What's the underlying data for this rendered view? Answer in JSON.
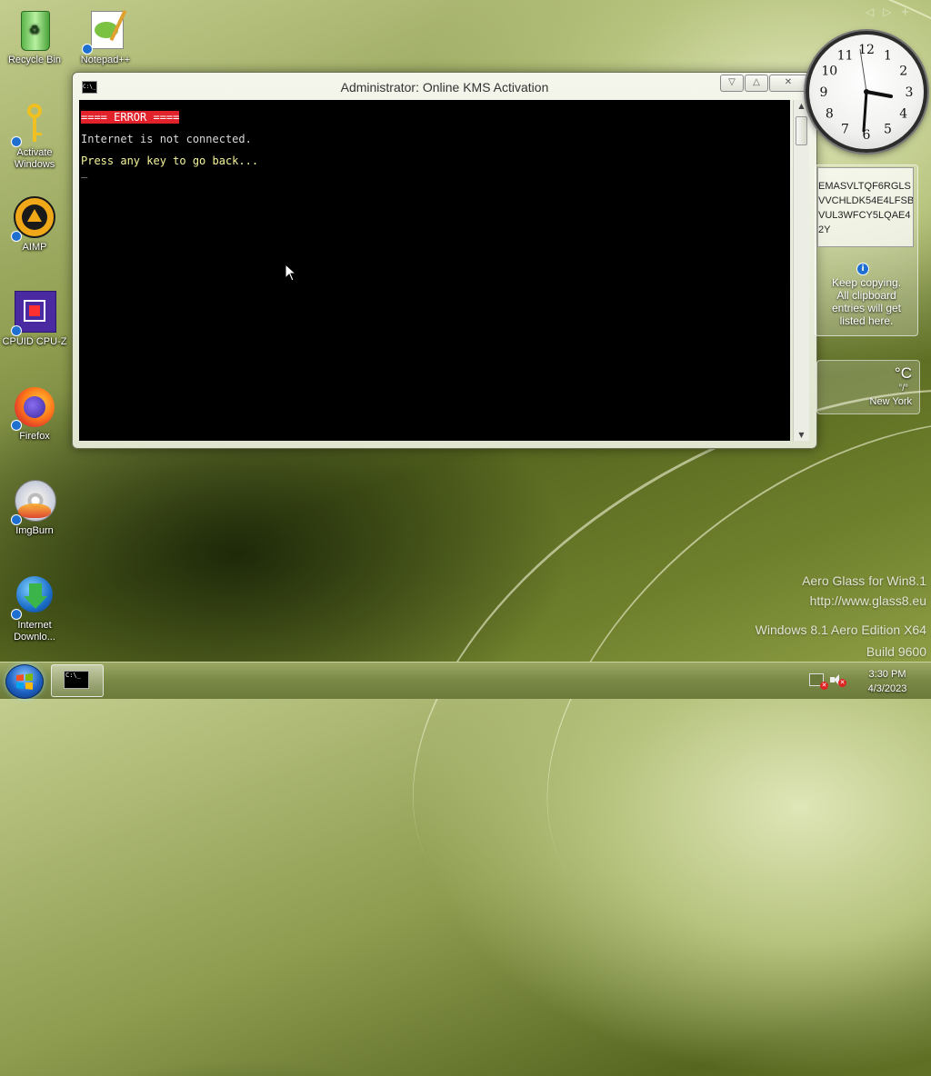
{
  "desktop": {
    "icons": [
      {
        "label": "Recycle Bin"
      },
      {
        "label": "Notepad++"
      },
      {
        "label": "Activate\nWindows"
      },
      {
        "label": "AIMP"
      },
      {
        "label": "CPUID CPU-Z"
      },
      {
        "label": "Firefox"
      },
      {
        "label": "ImgBurn"
      },
      {
        "label": "Internet\nDownlo..."
      }
    ]
  },
  "window": {
    "title": "Administrator:  Online KMS Activation",
    "title_icon_text": "C:\\_",
    "buttons": {
      "minimize": "▽",
      "maximize": "△",
      "close": "✕"
    },
    "console_lines": [
      {
        "text": "==== ERROR ====",
        "color": "#ffffff",
        "bg": "#e1222a"
      },
      {
        "text": "Internet is not connected.",
        "color": "#d8d8d8"
      },
      {
        "text": "Press any key to go back...",
        "color": "#f5f59a"
      }
    ],
    "cursor": "_"
  },
  "gadgets": {
    "clock": {
      "time": "3:30 PM",
      "numbers": [
        "12",
        "1",
        "2",
        "3",
        "4",
        "5",
        "6",
        "7",
        "8",
        "9",
        "10",
        "11"
      ]
    },
    "clipboard": {
      "entry_lines": [
        "EMASVLTQF6RGLS",
        "VVCHLDK54E4LFSB",
        "VUL3WFCY5LQAE4",
        "2Y"
      ],
      "info_icon": "i",
      "hint": "Keep copying.\nAll clipboard\nentries will get\nlisted here."
    },
    "weather": {
      "unit": "°C",
      "temp": "°/°",
      "city": "New York"
    }
  },
  "watermark": {
    "line1": "Aero Glass for Win8.1",
    "line2": "http://www.glass8.eu",
    "line3": "Windows 8.1 Aero Edition X64",
    "line4": "Build 9600"
  },
  "topright_arrows": [
    "◁",
    "▷",
    "+"
  ],
  "taskbar": {
    "console_icon_text": "C:\\_",
    "time": "3:30 PM",
    "date": "4/3/2023"
  }
}
